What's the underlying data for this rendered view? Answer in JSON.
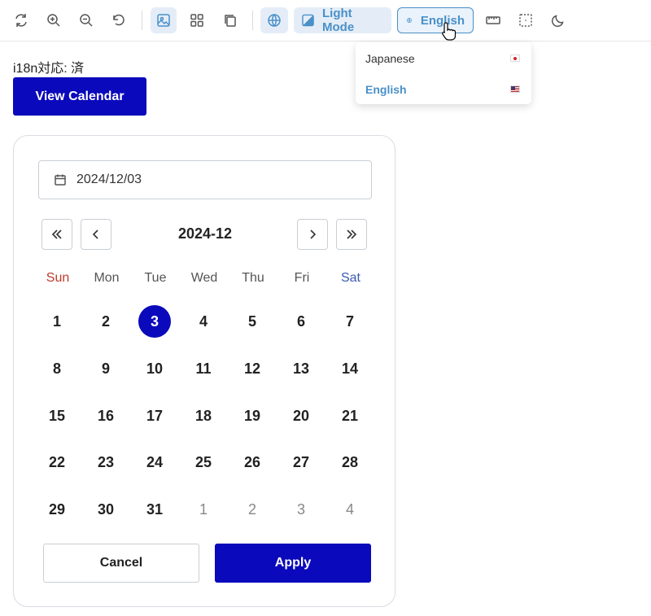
{
  "toolbar": {
    "icons": [
      "rotate-icon",
      "zoom-in-icon",
      "zoom-out-icon",
      "reset-icon",
      "image-icon",
      "grid-icon",
      "copy-icon",
      "globe-icon",
      "contrast-icon",
      "globe-icon",
      "ruler-icon",
      "focus-icon",
      "moon-icon"
    ],
    "theme_label": "Light Mode",
    "language_label": "English",
    "accent": "#4a90c8"
  },
  "language_menu": {
    "items": [
      {
        "label": "Japanese",
        "color": "#333333"
      },
      {
        "label": "English",
        "color": "#4a90c8"
      }
    ]
  },
  "page": {
    "status_text": "i18n対応: 済",
    "view_calendar_label": "View Calendar",
    "brand_color": "#0a09bb"
  },
  "date_picker": {
    "input_value": "2024/12/03",
    "month_title": "2024-12",
    "weekdays": [
      "Sun",
      "Mon",
      "Tue",
      "Wed",
      "Thu",
      "Fri",
      "Sat"
    ],
    "weeks": [
      [
        "1",
        "2",
        "3",
        "4",
        "5",
        "6",
        "7"
      ],
      [
        "8",
        "9",
        "10",
        "11",
        "12",
        "13",
        "14"
      ],
      [
        "15",
        "16",
        "17",
        "18",
        "19",
        "20",
        "21"
      ],
      [
        "22",
        "23",
        "24",
        "25",
        "26",
        "27",
        "28"
      ],
      [
        "29",
        "30",
        "31",
        "1",
        "2",
        "3",
        "4"
      ]
    ],
    "selected_day": "3",
    "cancel_label": "Cancel",
    "apply_label": "Apply"
  }
}
